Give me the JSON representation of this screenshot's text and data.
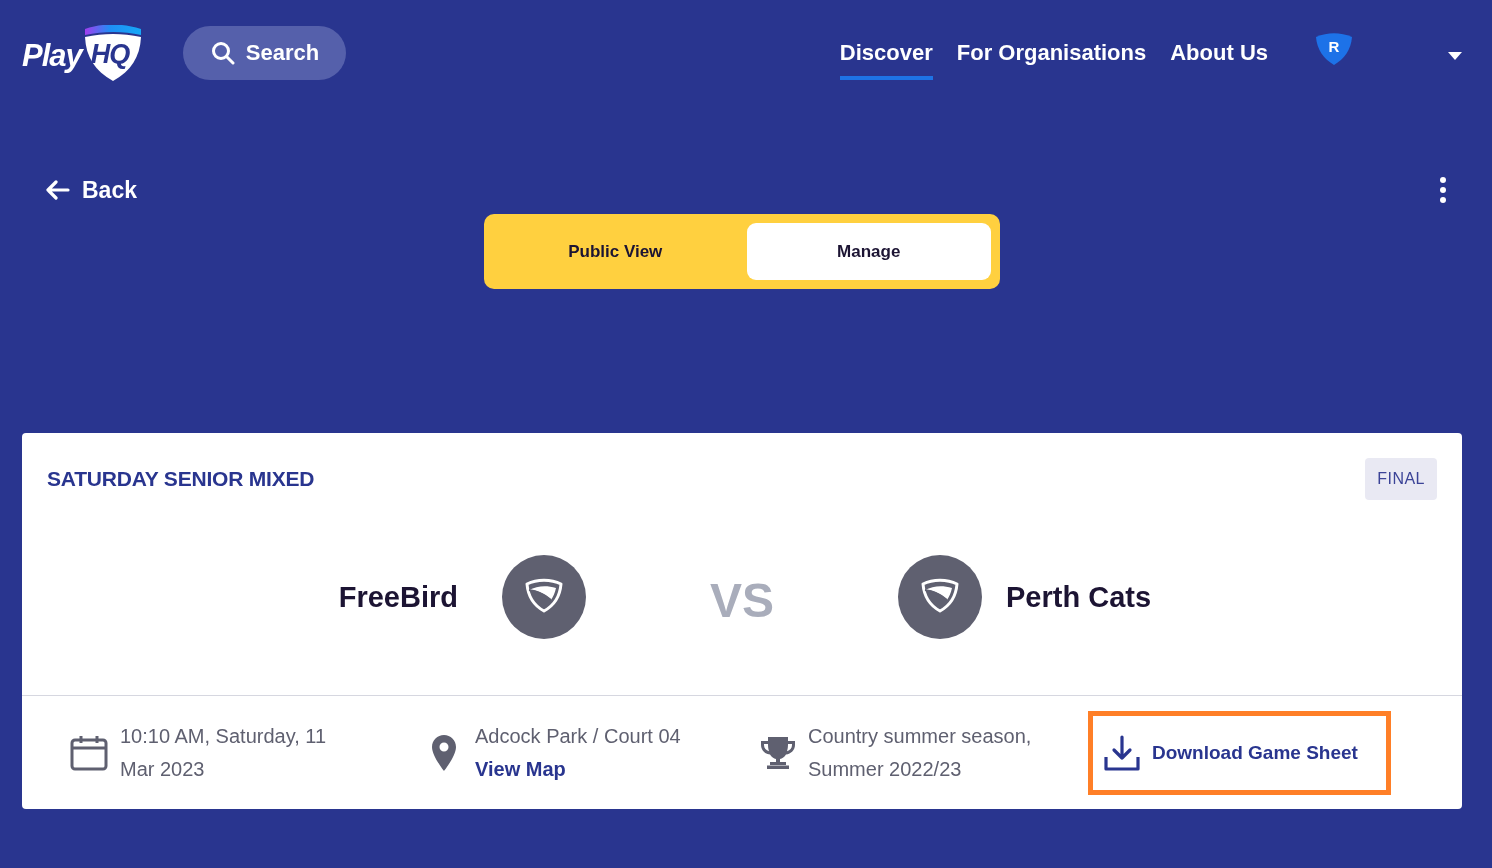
{
  "header": {
    "logo": {
      "wordmark": "Play",
      "badge": "HQ"
    },
    "search": {
      "label": "Search"
    },
    "nav": [
      {
        "label": "Discover",
        "selected": true
      },
      {
        "label": "For Organisations",
        "selected": false
      },
      {
        "label": "About Us",
        "selected": false
      }
    ],
    "avatar": {
      "initial": "R"
    }
  },
  "back": {
    "label": "Back"
  },
  "view_toggle": [
    {
      "label": "Public View",
      "selected": false
    },
    {
      "label": "Manage",
      "selected": true
    }
  ],
  "game": {
    "competition": "SATURDAY SENIOR MIXED",
    "status": "FINAL",
    "home_team": "FreeBird",
    "versus": "VS",
    "away_team": "Perth Cats",
    "details": [
      {
        "kind": "date",
        "text": "10:10 AM, Saturday, 11 Mar 2023"
      },
      {
        "kind": "venue",
        "text": "Adcock Park / Court 04",
        "link": "View Map"
      },
      {
        "kind": "season",
        "text": "Country summer season, Summer 2022/23"
      }
    ],
    "download": {
      "label": "Download Game Sheet"
    }
  }
}
